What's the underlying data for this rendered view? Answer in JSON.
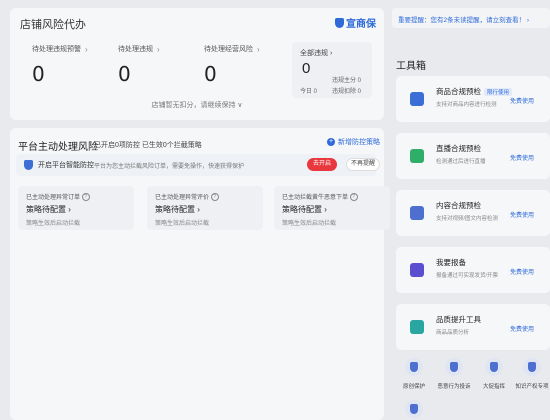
{
  "risk": {
    "title": "店铺风险代办",
    "brand": "宣商保",
    "metrics": [
      {
        "label": "待处理违规预警",
        "value": "0"
      },
      {
        "label": "待处理违规",
        "value": "0"
      },
      {
        "label": "待处理经营风险",
        "value": "0"
      }
    ],
    "panel": {
      "label": "全部违规",
      "value": "0",
      "today": "今日 0",
      "stat1": "违规主分 0",
      "stat2": "违规扣除 0"
    },
    "footnote": "店铺暂无扣分，请继续保持 ∨"
  },
  "proactive": {
    "title": "平台主动处理风险",
    "subtitle": "已开启0项防控 已生效0个拦截策略",
    "new_link": "新增防控策略",
    "banner": {
      "main": "开启平台智能防控",
      "desc": "平台为您主动拦截风险订单，需要免操作，快速获得保护",
      "enable": "去开启",
      "remind": "不再提醒"
    },
    "strategies": [
      {
        "header": "已主动处理异常订单",
        "main": "策略待配置",
        "sub": "策略生效后启动拦截"
      },
      {
        "header": "已主动处理异常评价",
        "main": "策略待配置",
        "sub": "策略生效后启动拦截"
      },
      {
        "header": "已主动拦截黄牛恶意下单",
        "main": "策略待配置",
        "sub": "策略生效后启动拦截"
      }
    ]
  },
  "notice": {
    "text": "重要提醒：您有2条未读提醒，请立刻查看！ ›"
  },
  "toolbox": {
    "title": "工具箱",
    "tools": [
      {
        "name": "商品合规预检",
        "tag": "限行使用",
        "desc": "支持对商品内容进行检测",
        "action": "免费使用",
        "color": "#3b6fd6"
      },
      {
        "name": "直播合规预检",
        "tag": "",
        "desc": "检测通过后进行直播",
        "action": "免费使用",
        "color": "#2fae6a"
      },
      {
        "name": "内容合规预检",
        "tag": "",
        "desc": "支持对视频/图文内容检测",
        "action": "免费使用",
        "color": "#4d6fd0"
      },
      {
        "name": "我要报备",
        "tag": "",
        "desc": "报备通过可实现发货/开票",
        "action": "免费使用",
        "color": "#5b4fcf"
      },
      {
        "name": "品质提升工具",
        "tag": "",
        "desc": "商品品质分析",
        "action": "免费使用",
        "color": "#2aa6a0"
      }
    ],
    "quick": [
      {
        "label": "原创保护"
      },
      {
        "label": "恶意行为投诉"
      },
      {
        "label": "大促指挥"
      },
      {
        "label": "知识产权专项"
      },
      {
        "label": ""
      }
    ]
  }
}
